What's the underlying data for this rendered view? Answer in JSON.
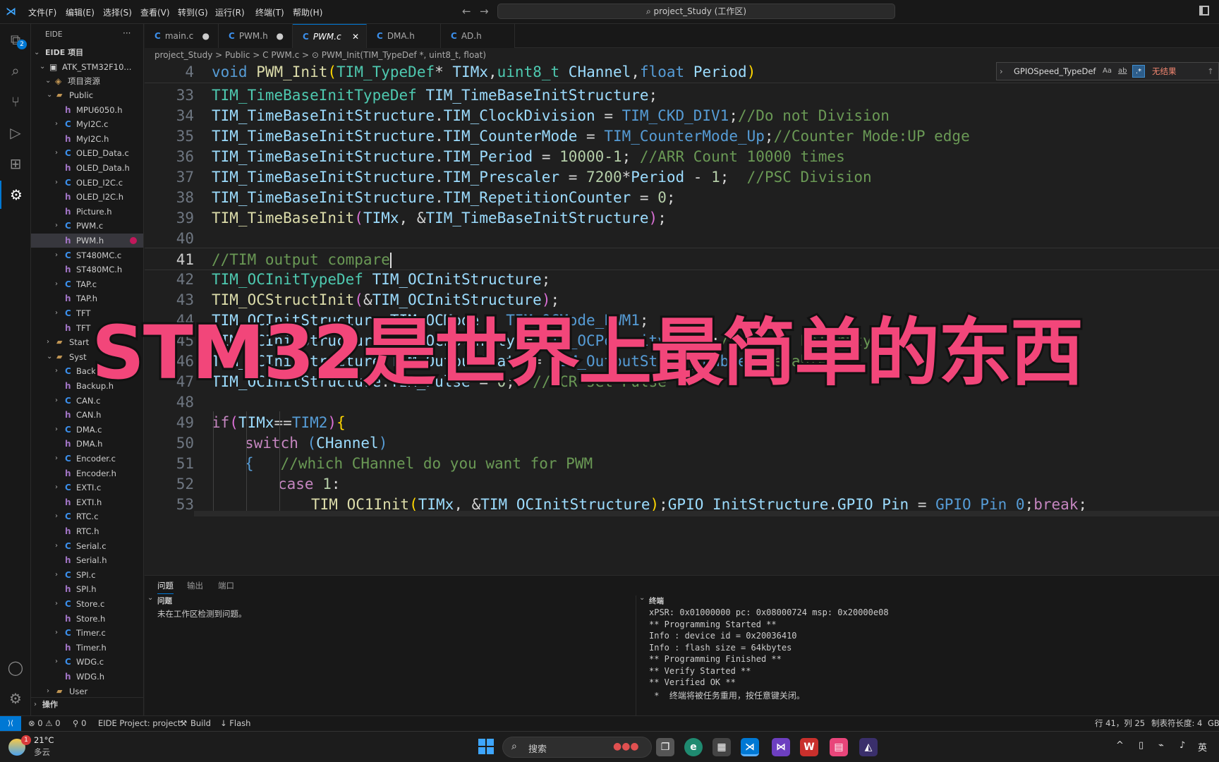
{
  "titlebar": {
    "menus": [
      "文件(F)",
      "编辑(E)",
      "选择(S)",
      "查看(V)",
      "转到(G)",
      "运行(R)",
      "终端(T)",
      "帮助(H)"
    ],
    "search": "project_Study (工作区)"
  },
  "activity_badge": "2",
  "sidebar": {
    "title": "EIDE",
    "more": "···",
    "section": "EIDE 项目",
    "project": "ATK_STM32F10...",
    "resources": "项目资源",
    "items": [
      {
        "label": "Public",
        "kind": "folder",
        "indent": 2,
        "open": true
      },
      {
        "label": "MPU6050.h",
        "kind": "h",
        "indent": 3
      },
      {
        "label": "MyI2C.c",
        "kind": "c",
        "indent": 3
      },
      {
        "label": "MyI2C.h",
        "kind": "h",
        "indent": 3
      },
      {
        "label": "OLED_Data.c",
        "kind": "c",
        "indent": 3
      },
      {
        "label": "OLED_Data.h",
        "kind": "h",
        "indent": 3
      },
      {
        "label": "OLED_I2C.c",
        "kind": "c",
        "indent": 3
      },
      {
        "label": "OLED_I2C.h",
        "kind": "h",
        "indent": 3
      },
      {
        "label": "Picture.h",
        "kind": "h",
        "indent": 3
      },
      {
        "label": "PWM.c",
        "kind": "c",
        "indent": 3
      },
      {
        "label": "PWM.h",
        "kind": "h",
        "indent": 3,
        "selected": true
      },
      {
        "label": "ST480MC.c",
        "kind": "c",
        "indent": 3
      },
      {
        "label": "ST480MC.h",
        "kind": "h",
        "indent": 3
      },
      {
        "label": "TAP.c",
        "kind": "c",
        "indent": 3
      },
      {
        "label": "TAP.h",
        "kind": "h",
        "indent": 3
      },
      {
        "label": "TFT",
        "kind": "c",
        "indent": 3
      },
      {
        "label": "TFT",
        "kind": "h",
        "indent": 3
      },
      {
        "label": "Start",
        "kind": "folder",
        "indent": 2,
        "open": false
      },
      {
        "label": "Syst",
        "kind": "folder",
        "indent": 2,
        "open": true
      },
      {
        "label": "Backup.c",
        "kind": "c",
        "indent": 3
      },
      {
        "label": "Backup.h",
        "kind": "h",
        "indent": 3
      },
      {
        "label": "CAN.c",
        "kind": "c",
        "indent": 3
      },
      {
        "label": "CAN.h",
        "kind": "h",
        "indent": 3
      },
      {
        "label": "DMA.c",
        "kind": "c",
        "indent": 3
      },
      {
        "label": "DMA.h",
        "kind": "h",
        "indent": 3
      },
      {
        "label": "Encoder.c",
        "kind": "c",
        "indent": 3
      },
      {
        "label": "Encoder.h",
        "kind": "h",
        "indent": 3
      },
      {
        "label": "EXTI.c",
        "kind": "c",
        "indent": 3
      },
      {
        "label": "EXTI.h",
        "kind": "h",
        "indent": 3
      },
      {
        "label": "RTC.c",
        "kind": "c",
        "indent": 3
      },
      {
        "label": "RTC.h",
        "kind": "h",
        "indent": 3
      },
      {
        "label": "Serial.c",
        "kind": "c",
        "indent": 3
      },
      {
        "label": "Serial.h",
        "kind": "h",
        "indent": 3
      },
      {
        "label": "SPI.c",
        "kind": "c",
        "indent": 3
      },
      {
        "label": "SPI.h",
        "kind": "h",
        "indent": 3
      },
      {
        "label": "Store.c",
        "kind": "c",
        "indent": 3
      },
      {
        "label": "Store.h",
        "kind": "h",
        "indent": 3
      },
      {
        "label": "Timer.c",
        "kind": "c",
        "indent": 3
      },
      {
        "label": "Timer.h",
        "kind": "h",
        "indent": 3
      },
      {
        "label": "WDG.c",
        "kind": "c",
        "indent": 3
      },
      {
        "label": "WDG.h",
        "kind": "h",
        "indent": 3
      },
      {
        "label": "User",
        "kind": "folder",
        "indent": 2,
        "open": false
      }
    ],
    "ops": "操作"
  },
  "tabs": [
    {
      "label": "main.c",
      "icon": "C",
      "modified": true
    },
    {
      "label": "PWM.h",
      "icon": "C",
      "modified": true
    },
    {
      "label": "PWM.c",
      "icon": "C",
      "active": true
    },
    {
      "label": "DMA.h",
      "icon": "C"
    },
    {
      "label": "AD.h",
      "icon": "C"
    }
  ],
  "breadcrumb": "project_Study  >  Public  >  C  PWM.c  >  ⊙ PWM_Init(TIM_TypeDef *, uint8_t, float)",
  "find": {
    "value": "GPIOSpeed_TypeDef",
    "opt1": "Aa",
    "opt2": "ab",
    "opt3": ".*",
    "result": "无结果"
  },
  "sticky": {
    "line": "4",
    "parts": [
      [
        "kw",
        "void "
      ],
      [
        "fn",
        "PWM_Init"
      ],
      [
        "br",
        "("
      ],
      [
        "ty",
        "TIM_TypeDef"
      ],
      [
        "pl",
        "* "
      ],
      [
        "vr",
        "TIMx"
      ],
      [
        "pl",
        ","
      ],
      [
        "ty",
        "uint8_t "
      ],
      [
        "vr",
        "CHannel"
      ],
      [
        "pl",
        ","
      ],
      [
        "kw",
        "float "
      ],
      [
        "vr",
        "Period"
      ],
      [
        "br",
        ")"
      ]
    ]
  },
  "code": [
    {
      "line": "33",
      "indent": 1,
      "parts": [
        [
          "ty",
          "TIM_TimeBaseInitTypeDef "
        ],
        [
          "vr",
          "TIM_TimeBaseInitStructure"
        ],
        [
          "pl",
          ";"
        ]
      ]
    },
    {
      "line": "34",
      "indent": 1,
      "parts": [
        [
          "vr",
          "TIM_TimeBaseInitStructure"
        ],
        [
          "pl",
          "."
        ],
        [
          "vr",
          "TIM_ClockDivision"
        ],
        [
          "pl",
          " = "
        ],
        [
          "kw",
          "TIM_CKD_DIV1"
        ],
        [
          "pl",
          ";"
        ],
        [
          "cm",
          "//Do not Division"
        ]
      ]
    },
    {
      "line": "35",
      "indent": 1,
      "parts": [
        [
          "vr",
          "TIM_TimeBaseInitStructure"
        ],
        [
          "pl",
          "."
        ],
        [
          "vr",
          "TIM_CounterMode"
        ],
        [
          "pl",
          " = "
        ],
        [
          "kw",
          "TIM_CounterMode_Up"
        ],
        [
          "pl",
          ";"
        ],
        [
          "cm",
          "//Counter Mode:UP edge"
        ]
      ]
    },
    {
      "line": "36",
      "indent": 1,
      "parts": [
        [
          "vr",
          "TIM_TimeBaseInitStructure"
        ],
        [
          "pl",
          "."
        ],
        [
          "vr",
          "TIM_Period"
        ],
        [
          "pl",
          " = "
        ],
        [
          "nm",
          "10000-1"
        ],
        [
          "pl",
          "; "
        ],
        [
          "cm",
          "//ARR Count 10000 times"
        ]
      ]
    },
    {
      "line": "37",
      "indent": 1,
      "parts": [
        [
          "vr",
          "TIM_TimeBaseInitStructure"
        ],
        [
          "pl",
          "."
        ],
        [
          "vr",
          "TIM_Prescaler"
        ],
        [
          "pl",
          " = "
        ],
        [
          "nm",
          "7200"
        ],
        [
          "pl",
          "*"
        ],
        [
          "vr",
          "Period"
        ],
        [
          "pl",
          " - "
        ],
        [
          "nm",
          "1"
        ],
        [
          "pl",
          ";  "
        ],
        [
          "cm",
          "//PSC Division"
        ]
      ]
    },
    {
      "line": "38",
      "indent": 1,
      "parts": [
        [
          "vr",
          "TIM_TimeBaseInitStructure"
        ],
        [
          "pl",
          "."
        ],
        [
          "vr",
          "TIM_RepetitionCounter"
        ],
        [
          "pl",
          " = "
        ],
        [
          "nm",
          "0"
        ],
        [
          "pl",
          ";"
        ]
      ]
    },
    {
      "line": "39",
      "indent": 1,
      "parts": [
        [
          "fn",
          "TIM_TimeBaseInit"
        ],
        [
          "br2",
          "("
        ],
        [
          "vr",
          "TIMx"
        ],
        [
          "pl",
          ", &"
        ],
        [
          "vr",
          "TIM_TimeBaseInitStructure"
        ],
        [
          "br2",
          ")"
        ],
        [
          "pl",
          ";"
        ]
      ]
    },
    {
      "line": "40",
      "indent": 0,
      "parts": []
    },
    {
      "line": "41",
      "indent": 1,
      "current": true,
      "parts": [
        [
          "cm",
          "//TIM output compare"
        ]
      ]
    },
    {
      "line": "42",
      "indent": 1,
      "parts": [
        [
          "ty",
          "TIM_OCInitTypeDef "
        ],
        [
          "vr",
          "TIM_OCInitStructure"
        ],
        [
          "pl",
          ";"
        ]
      ]
    },
    {
      "line": "43",
      "indent": 1,
      "parts": [
        [
          "fn",
          "TIM_OCStructInit"
        ],
        [
          "br2",
          "("
        ],
        [
          "pl",
          "&"
        ],
        [
          "vr",
          "TIM_OCInitStructure"
        ],
        [
          "br2",
          ")"
        ],
        [
          "pl",
          ";"
        ]
      ]
    },
    {
      "line": "44",
      "indent": 1,
      "parts": [
        [
          "vr",
          "TIM_OCInitStructure"
        ],
        [
          "pl",
          "."
        ],
        [
          "vr",
          "TIM_OCMode"
        ],
        [
          "pl",
          " = "
        ],
        [
          "kw",
          "TIM_OCMode_PWM1"
        ],
        [
          "pl",
          ";"
        ]
      ]
    },
    {
      "line": "45",
      "indent": 1,
      "parts": [
        [
          "vr",
          "TIM_OCInitStructure"
        ],
        [
          "pl",
          "."
        ],
        [
          "vr",
          "TIM_OCPolarity"
        ],
        [
          "pl",
          " = "
        ],
        [
          "kw",
          "TIM_OCPolarity_High"
        ],
        [
          "pl",
          ";"
        ],
        [
          "cm",
          "//choose Polarity"
        ]
      ]
    },
    {
      "line": "46",
      "indent": 1,
      "parts": [
        [
          "vr",
          "TIM_OCInitStructure"
        ],
        [
          "pl",
          "."
        ],
        [
          "vr",
          "TIM_OutputState"
        ],
        [
          "pl",
          " = "
        ],
        [
          "kw",
          "TIM_OutputState_Enable"
        ],
        [
          "pl",
          ";"
        ],
        [
          "cm",
          "//enable"
        ]
      ]
    },
    {
      "line": "47",
      "indent": 1,
      "parts": [
        [
          "vr",
          "TIM_OCInitStructure"
        ],
        [
          "pl",
          "."
        ],
        [
          "vr",
          "TIM_Pulse"
        ],
        [
          "pl",
          " = "
        ],
        [
          "nm",
          "0"
        ],
        [
          "pl",
          ";  "
        ],
        [
          "cm",
          "//CCR set Pulse"
        ]
      ]
    },
    {
      "line": "48",
      "indent": 0,
      "parts": []
    },
    {
      "line": "49",
      "indent": 1,
      "parts": [
        [
          "kc",
          "if"
        ],
        [
          "br2",
          "("
        ],
        [
          "vr",
          "TIMx"
        ],
        [
          "pl",
          "=="
        ],
        [
          "kw",
          "TIM2"
        ],
        [
          "br2",
          ")"
        ],
        [
          "br",
          "{"
        ]
      ]
    },
    {
      "line": "50",
      "indent": 2,
      "parts": [
        [
          "kc",
          "switch "
        ],
        [
          "kw",
          "("
        ],
        [
          "vr",
          "CHannel"
        ],
        [
          "kw",
          ")"
        ]
      ]
    },
    {
      "line": "51",
      "indent": 2,
      "parts": [
        [
          "kw",
          "{"
        ],
        [
          "pl",
          "   "
        ],
        [
          "cm",
          "//which CHannel do you want for PWM"
        ]
      ]
    },
    {
      "line": "52",
      "indent": 3,
      "parts": [
        [
          "kc",
          "case "
        ],
        [
          "nm",
          "1"
        ],
        [
          "pl",
          ":"
        ]
      ]
    },
    {
      "line": "53",
      "indent": 4,
      "parts": [
        [
          "fn",
          "TIM_OC1Init"
        ],
        [
          "br",
          "("
        ],
        [
          "vr",
          "TIMx"
        ],
        [
          "pl",
          ", &"
        ],
        [
          "vr",
          "TIM_OCInitStructure"
        ],
        [
          "br",
          ")"
        ],
        [
          "pl",
          ";"
        ],
        [
          "vr",
          "GPIO_InitStructure"
        ],
        [
          "pl",
          "."
        ],
        [
          "vr",
          "GPIO_Pin"
        ],
        [
          "pl",
          " = "
        ],
        [
          "kw",
          "GPIO_Pin_0"
        ],
        [
          "pl",
          ";"
        ],
        [
          "kc",
          "break"
        ],
        [
          "pl",
          ";"
        ]
      ]
    }
  ],
  "overlay_text": "STM32是世界上最简单的东西",
  "panel": {
    "tabs": [
      "问题",
      "输出",
      "端口"
    ],
    "problems_title": "问题",
    "problems_text": "未在工作区检测到问题。",
    "terminal_title": "终端",
    "terminal_lines": [
      "xPSR: 0x01000000 pc: 0x08000724 msp: 0x20000e08",
      "** Programming Started **",
      "Info : device id = 0x20036410",
      "Info : flash size = 64kbytes",
      "** Programming Finished **",
      "** Verify Started **",
      "** Verified OK **",
      " *  终端将被任务重用，按任意键关闭。"
    ]
  },
  "status": {
    "remote": "⟩⟨",
    "errors": "⊗ 0 ⚠ 0",
    "ports": "⚲ 0",
    "project": "EIDE Project: project",
    "build": "Build",
    "flash": "↓ Flash",
    "position": "行 41，列 25",
    "tabsize": "制表符长度: 4",
    "encoding": "GB"
  },
  "taskbar": {
    "weather_badge": "1",
    "temp": "21°C",
    "cond": "多云",
    "search": "搜索",
    "lang": "英"
  }
}
